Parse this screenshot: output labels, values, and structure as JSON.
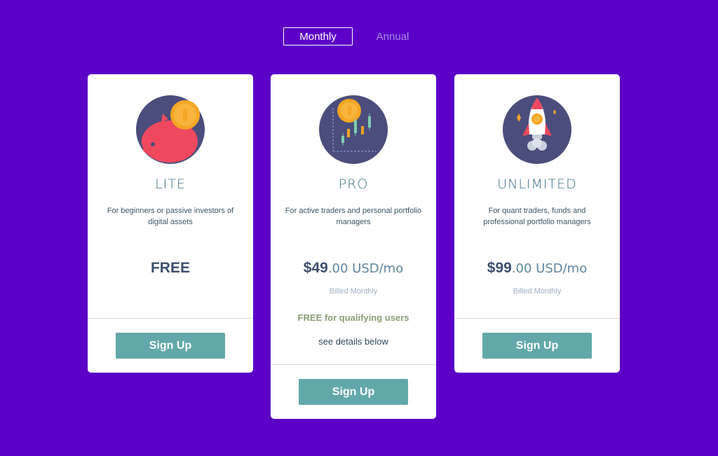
{
  "billing_toggle": {
    "monthly_label": "Monthly",
    "annual_label": "Annual",
    "selected": "Monthly"
  },
  "plans": [
    {
      "name": "LITE",
      "description": "For beginners or passive investors of digital assets",
      "price_amount": "FREE",
      "price_suffix": "",
      "billing": "",
      "signup_label": "Sign Up",
      "icon": "piggy-bank-icon"
    },
    {
      "name": "PRO",
      "description": "For active traders and personal portfolio managers",
      "price_amount": "$49",
      "price_suffix": ".00 USD/mo",
      "billing": "Billed Monthly",
      "promo": "FREE for qualifying users",
      "details_link": "see details below",
      "signup_label": "Sign Up",
      "icon": "candlestick-chart-icon"
    },
    {
      "name": "UNLIMITED",
      "description": "For quant traders, funds and professional portfolio managers",
      "price_amount": "$99",
      "price_suffix": ".00 USD/mo",
      "billing": "Billed Monthly",
      "signup_label": "Sign Up",
      "icon": "rocket-icon"
    }
  ],
  "colors": {
    "background": "#5c00c7",
    "card": "#ffffff",
    "button": "#62a8aa",
    "icon_circle": "#4b4d7c",
    "coin": "#f5a623",
    "accent_red": "#f0495f"
  }
}
